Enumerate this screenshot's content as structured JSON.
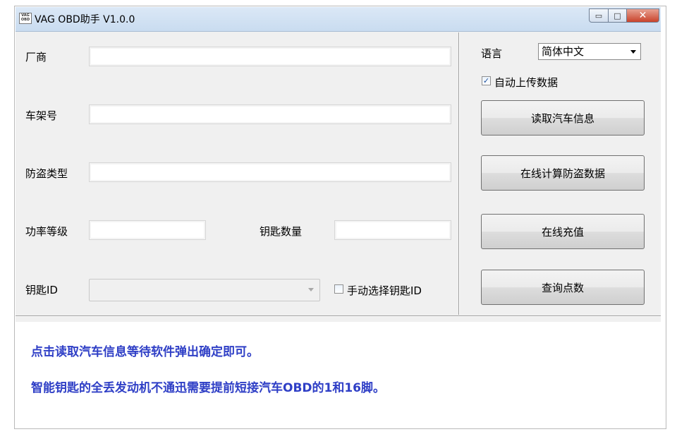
{
  "window": {
    "title": "VAG OBD助手 V1.0.0",
    "icon_text": "VAG\nOBD",
    "minimize_glyph": "▭",
    "maximize_glyph": "□",
    "close_glyph": "✕"
  },
  "form": {
    "manufacturer_label": "厂商",
    "manufacturer_value": "",
    "vin_label": "车架号",
    "vin_value": "",
    "immo_type_label": "防盗类型",
    "immo_type_value": "",
    "power_level_label": "功率等级",
    "power_level_value": "",
    "key_count_label": "钥匙数量",
    "key_count_value": "",
    "key_id_label": "钥匙ID",
    "key_id_value": "",
    "manual_key_label": "手动选择钥匙ID",
    "manual_key_checked": false
  },
  "side": {
    "language_label": "语言",
    "language_value": "简体中文",
    "auto_upload_label": "自动上传数据",
    "auto_upload_checked": true,
    "read_car_info": "读取汽车信息",
    "online_calc": "在线计算防盗数据",
    "online_recharge": "在线充值",
    "query_points": "查询点数"
  },
  "notes": {
    "line1": "点击读取汽车信息等待软件弹出确定即可。",
    "line2": "智能钥匙的全丢发动机不通迅需要提前短接汽车OBD的1和16脚。"
  },
  "colors": {
    "note_text": "#2f3fc6",
    "titlebar": "#c9dcf0",
    "close_button": "#c9432b"
  }
}
